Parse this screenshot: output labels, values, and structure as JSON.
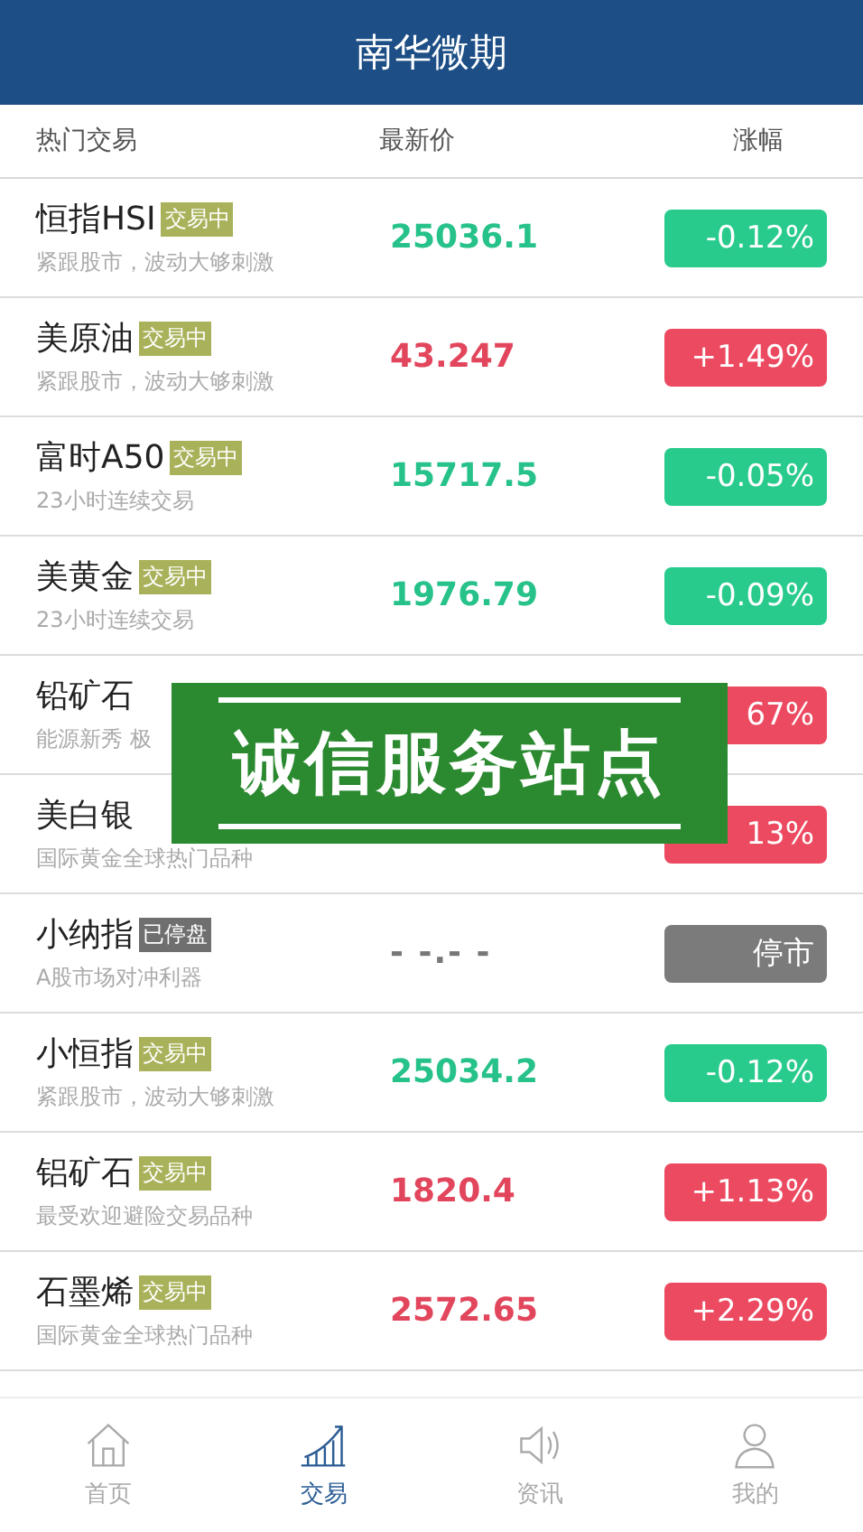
{
  "header": {
    "title": "南华微期"
  },
  "columns": [
    "热门交易",
    "最新价",
    "涨幅"
  ],
  "rows": [
    {
      "name": "恒指HSI",
      "badge": {
        "text": "交易中",
        "kind": "trading"
      },
      "subtitle": "紧跟股市，波动大够刺激",
      "price": "25036.1",
      "change": "-0.12%",
      "kind": "down"
    },
    {
      "name": "美原油",
      "badge": {
        "text": "交易中",
        "kind": "trading"
      },
      "subtitle": "紧跟股市，波动大够刺激",
      "price": "43.247",
      "change": "+1.49%",
      "kind": "up"
    },
    {
      "name": "富时A50",
      "badge": {
        "text": "交易中",
        "kind": "trading"
      },
      "subtitle": "23小时连续交易",
      "price": "15717.5",
      "change": "-0.05%",
      "kind": "down"
    },
    {
      "name": "美黄金",
      "badge": {
        "text": "交易中",
        "kind": "trading"
      },
      "subtitle": "23小时连续交易",
      "price": "1976.79",
      "change": "-0.09%",
      "kind": "down"
    },
    {
      "name": "铅矿石",
      "subtitle": "能源新秀 极",
      "change": "67%",
      "kind": "up"
    },
    {
      "name": "美白银",
      "subtitle": "国际黄金全球热门品种",
      "change": "13%",
      "kind": "up"
    },
    {
      "name": "小纳指",
      "badge": {
        "text": "已停盘",
        "kind": "closed"
      },
      "subtitle": "A股市场对冲利器",
      "price": "- -.- -",
      "change": "停市",
      "kind": "halted"
    },
    {
      "name": "小恒指",
      "badge": {
        "text": "交易中",
        "kind": "trading"
      },
      "subtitle": "紧跟股市，波动大够刺激",
      "price": "25034.2",
      "change": "-0.12%",
      "kind": "down"
    },
    {
      "name": "铝矿石",
      "badge": {
        "text": "交易中",
        "kind": "trading"
      },
      "subtitle": "最受欢迎避险交易品种",
      "price": "1820.4",
      "change": "+1.13%",
      "kind": "up"
    },
    {
      "name": "石墨烯",
      "badge": {
        "text": "交易中",
        "kind": "trading"
      },
      "subtitle": "国际黄金全球热门品种",
      "price": "2572.65",
      "change": "+2.29%",
      "kind": "up"
    }
  ],
  "banner": {
    "text": "诚信服务站点"
  },
  "tabs": [
    {
      "label": "首页",
      "selected": false
    },
    {
      "label": "交易",
      "selected": true
    },
    {
      "label": "资讯",
      "selected": false
    },
    {
      "label": "我的",
      "selected": false
    }
  ]
}
